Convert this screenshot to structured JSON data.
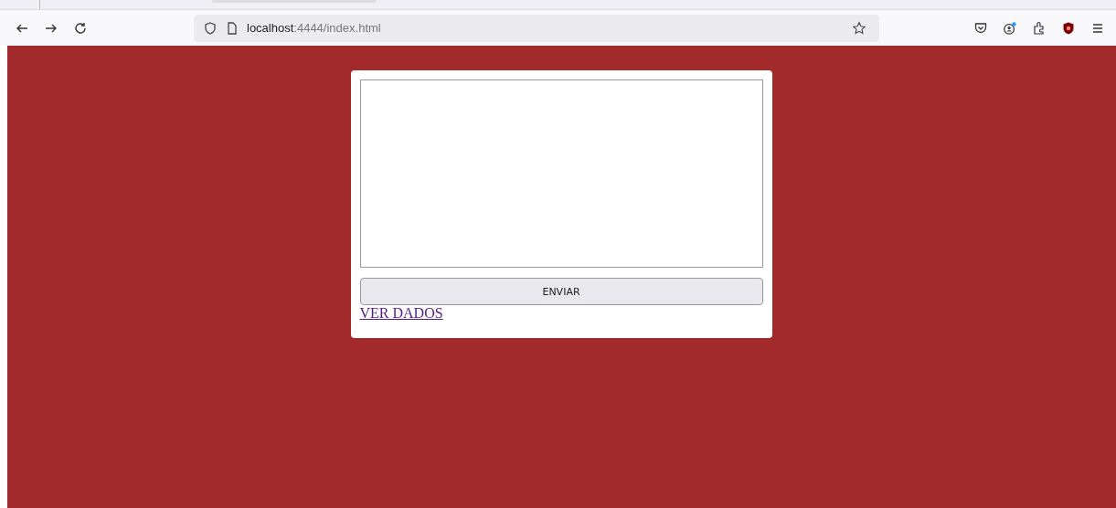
{
  "browser": {
    "url_host": "localhost",
    "url_path": ":4444/index.html"
  },
  "form": {
    "submit_button": "ENVIAR",
    "view_link": "VER DADOS"
  }
}
